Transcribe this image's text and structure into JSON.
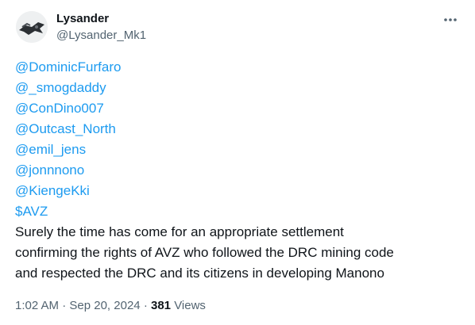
{
  "author": {
    "display_name": "Lysander",
    "handle": "@Lysander_Mk1"
  },
  "header": {
    "more_icon": "more-horizontal-icon"
  },
  "tweet": {
    "mentions": [
      "@DominicFurfaro",
      "@_smogdaddy",
      "@ConDino007",
      "@Outcast_North",
      "@emil_jens",
      "@jonnnono",
      "@KiengeKki",
      "$AVZ"
    ],
    "text": "Surely the time has come for an appropriate settlement\nconfirming the rights of AVZ who followed the DRC mining code\nand respected the DRC and its citizens in developing Manono"
  },
  "meta": {
    "time": "1:02 AM",
    "separator": "·",
    "date": "Sep 20, 2024",
    "views_count": "381",
    "views_label": "Views"
  },
  "colors": {
    "link": "#1d9bf0",
    "text": "#0f1419",
    "secondary": "#536471"
  }
}
